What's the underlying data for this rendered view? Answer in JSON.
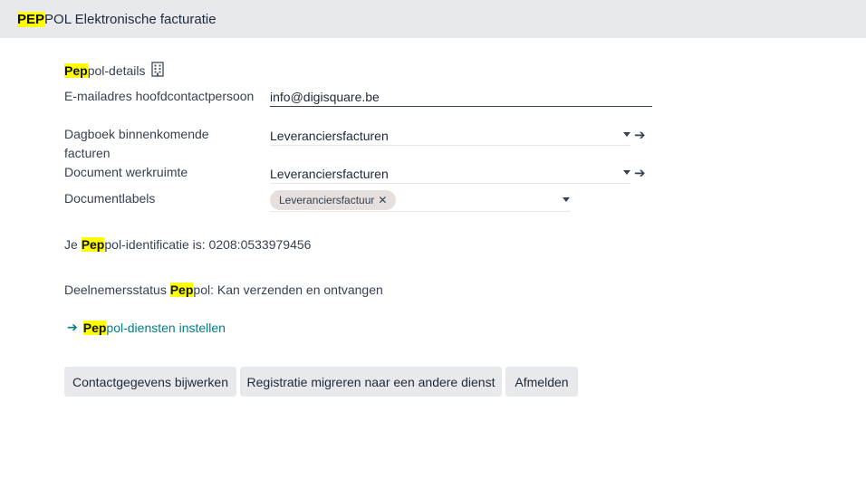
{
  "header": {
    "title_hl": "PEP",
    "title_rest": "POL Elektronische facturatie"
  },
  "section": {
    "title_hl": "Pep",
    "title_rest": "pol-details",
    "icon": "building-icon"
  },
  "fields": {
    "email": {
      "label": "E-mailadres hoofdcontactpersoon",
      "value": "info@digisquare.be"
    },
    "journal": {
      "label": "Dagboek binnenkomende facturen",
      "value": "Leveranciersfacturen"
    },
    "workspace": {
      "label": "Document werkruimte",
      "value": "Leveranciersfacturen"
    },
    "tags": {
      "label": "Documentlabels",
      "items": [
        "Leveranciersfactuur"
      ]
    }
  },
  "identification": {
    "prefix": "Je ",
    "hl": "Pep",
    "rest": "pol-identificatie is: 0208:0533979456"
  },
  "status": {
    "prefix": "Deelnemersstatus ",
    "hl": "Pep",
    "rest": "pol: Kan verzenden en ontvangen"
  },
  "setup_link": {
    "hl": "Pep",
    "rest": "pol-diensten instellen"
  },
  "buttons": {
    "update": "Contactgegevens bijwerken",
    "migrate": "Registratie migreren naar een andere dienst",
    "unsubscribe": "Afmelden"
  },
  "colors": {
    "highlight": "#ffff00",
    "link": "#017e84",
    "header_bg": "#e7e9ed",
    "button_bg": "#e7e9ed",
    "tag_bg": "#e5dfdd"
  }
}
